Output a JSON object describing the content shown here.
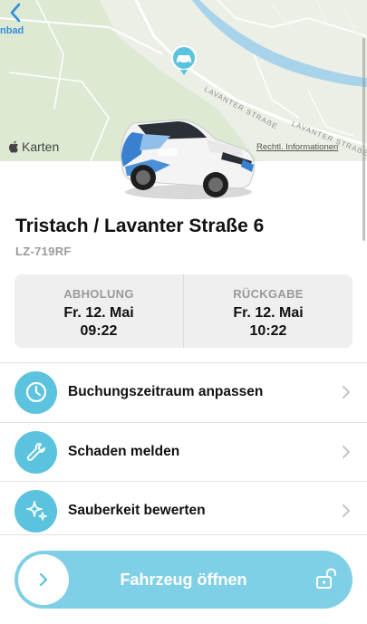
{
  "map": {
    "back_label": "nbad",
    "maps_brand": "Karten",
    "legal_link": "Rechtl. Informationen",
    "street_label_1": "LAVANTER STRAẞE",
    "street_label_2": "LAVANTER STRAẞE",
    "pin_icon": "car-pin-icon"
  },
  "vehicle": {
    "title": "Tristach / Lavanter Straße 6",
    "plate": "LZ-719RF"
  },
  "booking": {
    "pickup_caption": "ABHOLUNG",
    "pickup_date": "Fr. 12. Mai",
    "pickup_time": "09:22",
    "return_caption": "RÜCKGABE",
    "return_date": "Fr. 12. Mai",
    "return_time": "10:22"
  },
  "actions": [
    {
      "label": "Buchungszeitraum anpassen",
      "icon": "clock-icon"
    },
    {
      "label": "Schaden melden",
      "icon": "wrench-icon"
    },
    {
      "label": "Sauberkeit bewerten",
      "icon": "sparkle-icon"
    }
  ],
  "open_button": {
    "label": "Fahrzeug öffnen",
    "lock_icon": "unlock-icon"
  },
  "colors": {
    "accent": "#5bc3de",
    "slider": "#7fd0e6",
    "link": "#2f8ee0"
  }
}
